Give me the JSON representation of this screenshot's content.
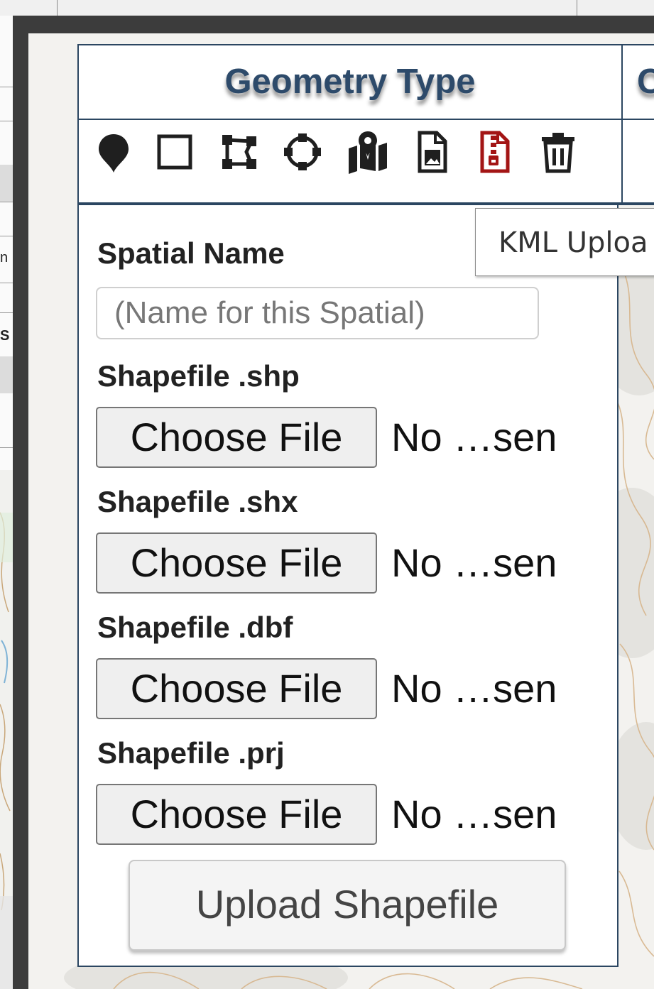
{
  "panel": {
    "column_title": "Geometry Type",
    "next_column_title_partial": "C"
  },
  "tools": [
    {
      "name": "point",
      "icon": "map-marker-icon"
    },
    {
      "name": "rectangle",
      "icon": "square-outline-icon"
    },
    {
      "name": "polygon",
      "icon": "draw-polygon-icon"
    },
    {
      "name": "circle",
      "icon": "circle-outline-icon"
    },
    {
      "name": "multi",
      "icon": "map-marked-icon"
    },
    {
      "name": "file-upload",
      "icon": "file-image-icon"
    },
    {
      "name": "shapefile-upload",
      "icon": "file-archive-icon",
      "color": "#a31515"
    },
    {
      "name": "delete",
      "icon": "trash-icon"
    }
  ],
  "tooltip": {
    "text": "KML Uploa"
  },
  "form": {
    "spatial_name_label": "Spatial Name",
    "spatial_name_placeholder": "(Name for this Spatial)",
    "files": [
      {
        "label": "Shapefile .shp",
        "button": "Choose File",
        "status": "No …sen"
      },
      {
        "label": "Shapefile .shx",
        "button": "Choose File",
        "status": "No …sen"
      },
      {
        "label": "Shapefile .dbf",
        "button": "Choose File",
        "status": "No …sen"
      },
      {
        "label": "Shapefile .prj",
        "button": "Choose File",
        "status": "No …sen"
      }
    ],
    "submit_label": "Upload Shapefile"
  },
  "background": {
    "left_letters": [
      "n",
      "S"
    ]
  },
  "colors": {
    "header_text": "#2d4a6a",
    "panel_border": "#2b4661",
    "frame": "#3c3c3c",
    "accent_red": "#a31515"
  }
}
